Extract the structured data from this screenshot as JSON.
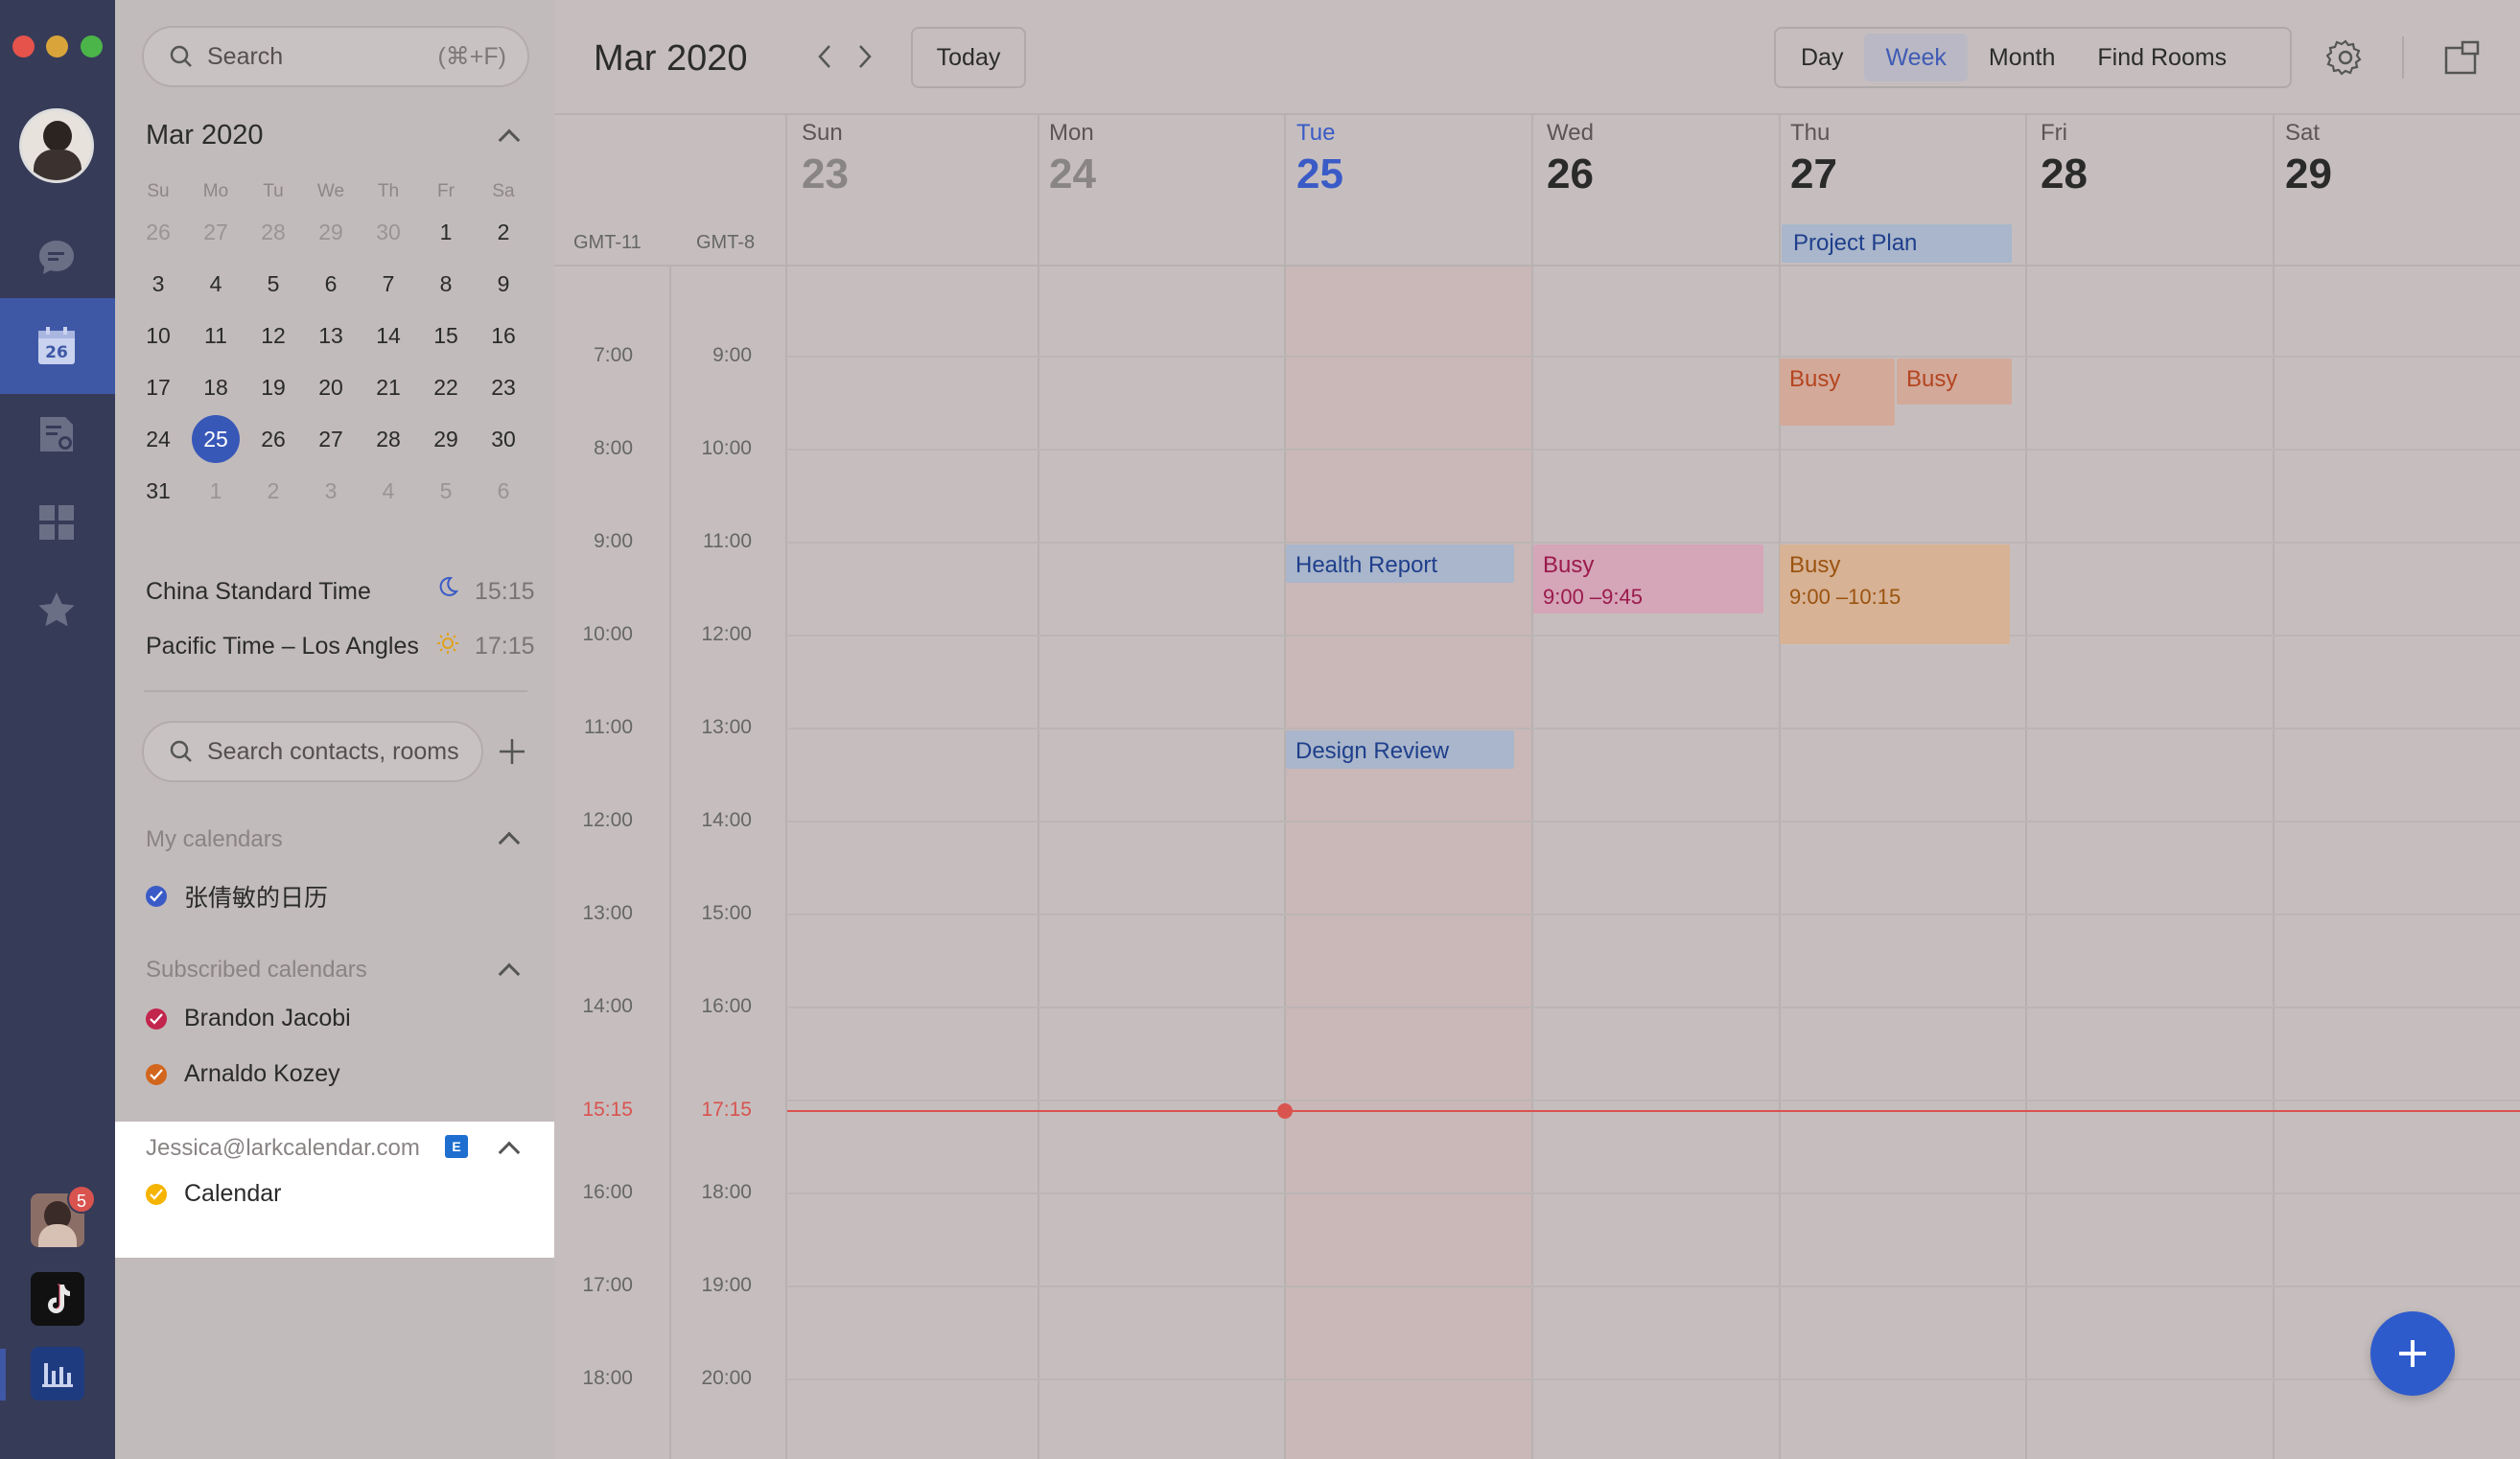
{
  "rail": {
    "nav": [
      {
        "name": "messenger-icon"
      },
      {
        "name": "calendar-icon",
        "label": "26",
        "active": true
      },
      {
        "name": "docs-icon"
      },
      {
        "name": "workplace-icon"
      },
      {
        "name": "favorites-icon"
      }
    ],
    "bottom_badge": "5"
  },
  "sidebar": {
    "search": {
      "placeholder": "Search",
      "shortcut": "(⌘+F)"
    },
    "mini_calendar": {
      "title": "Mar 2020",
      "weekdays": [
        "Su",
        "Mo",
        "Tu",
        "We",
        "Th",
        "Fr",
        "Sa"
      ],
      "weeks": [
        [
          "26",
          "27",
          "28",
          "29",
          "30",
          "1",
          "2"
        ],
        [
          "3",
          "4",
          "5",
          "6",
          "7",
          "8",
          "9"
        ],
        [
          "10",
          "11",
          "12",
          "13",
          "14",
          "15",
          "16"
        ],
        [
          "17",
          "18",
          "19",
          "20",
          "21",
          "22",
          "23"
        ],
        [
          "24",
          "25",
          "26",
          "27",
          "28",
          "29",
          "30"
        ],
        [
          "31",
          "1",
          "2",
          "3",
          "4",
          "5",
          "6"
        ]
      ],
      "selected": "25"
    },
    "timezones": [
      {
        "name": "China Standard Time",
        "time": "15:15",
        "icon": "moon-icon"
      },
      {
        "name": "Pacific Time – Los Angles",
        "time": "17:15",
        "icon": "sun-icon"
      }
    ],
    "contact_search": {
      "placeholder": "Search contacts, rooms"
    },
    "my_calendars": {
      "title": "My calendars",
      "items": [
        {
          "label": "张倩敏的日历",
          "color": "#3a5bc7"
        }
      ]
    },
    "subscribed": {
      "title": "Subscribed calendars",
      "items": [
        {
          "label": "Brandon Jacobi",
          "color": "#c2264d"
        },
        {
          "label": "Arnaldo Kozey",
          "color": "#d2661d"
        }
      ]
    },
    "account": {
      "email": "Jessica@larkcalendar.com",
      "items": [
        {
          "label": "Calendar",
          "color": "#f5b400"
        }
      ]
    }
  },
  "toolbar": {
    "title": "Mar 2020",
    "today": "Today",
    "views": [
      "Day",
      "Week",
      "Month",
      "Find Rooms"
    ],
    "active_view": "Week"
  },
  "week": {
    "days": [
      {
        "name": "Sun",
        "num": "23"
      },
      {
        "name": "Mon",
        "num": "24"
      },
      {
        "name": "Tue",
        "num": "25",
        "today": true
      },
      {
        "name": "Wed",
        "num": "26"
      },
      {
        "name": "Thu",
        "num": "27"
      },
      {
        "name": "Fri",
        "num": "28"
      },
      {
        "name": "Sat",
        "num": "29"
      }
    ],
    "tz_left": "GMT-11",
    "tz_right": "GMT-8",
    "hours_left": [
      "7:00",
      "8:00",
      "9:00",
      "10:00",
      "11:00",
      "12:00",
      "13:00",
      "14:00",
      "15:15",
      "16:00",
      "17:00",
      "18:00"
    ],
    "hours_right": [
      "9:00",
      "10:00",
      "11:00",
      "12:00",
      "13:00",
      "14:00",
      "15:00",
      "16:00",
      "17:15",
      "18:00",
      "19:00",
      "20:00"
    ],
    "all_day": [
      {
        "title": "Project Plan"
      }
    ],
    "events": [
      {
        "title": "Busy",
        "time": ""
      },
      {
        "title": "Busy",
        "time": ""
      },
      {
        "title": "Health Report",
        "time": ""
      },
      {
        "title": "Busy",
        "time": "9:00 –9:45"
      },
      {
        "title": "Busy",
        "time": "9:00 –10:15"
      },
      {
        "title": "Design Review",
        "time": ""
      }
    ]
  }
}
